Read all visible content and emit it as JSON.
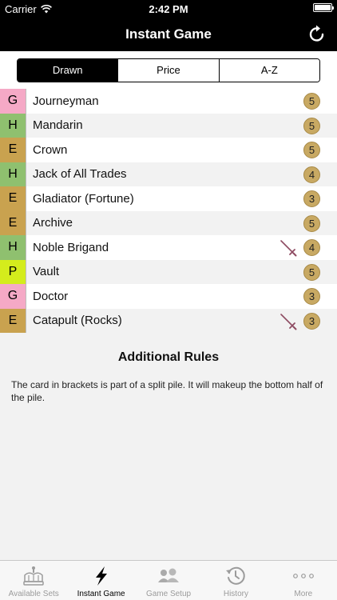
{
  "status_bar": {
    "carrier": "Carrier",
    "time": "2:42 PM",
    "battery_level": 1.0
  },
  "nav": {
    "title": "Instant Game",
    "refresh_icon": "refresh-icon"
  },
  "segments": [
    {
      "label": "Drawn",
      "active": true
    },
    {
      "label": "Price",
      "active": false
    },
    {
      "label": "A-Z",
      "active": false
    }
  ],
  "set_colors": {
    "G": "#f5a9c6",
    "H": "#8fc06f",
    "E": "#c9a24f",
    "P": "#d4ec1c"
  },
  "cards": [
    {
      "set": "G",
      "name": "Journeyman",
      "cost": "5",
      "attack": false
    },
    {
      "set": "H",
      "name": "Mandarin",
      "cost": "5",
      "attack": false
    },
    {
      "set": "E",
      "name": "Crown",
      "cost": "5",
      "attack": false
    },
    {
      "set": "H",
      "name": "Jack of All Trades",
      "cost": "4",
      "attack": false
    },
    {
      "set": "E",
      "name": "Gladiator (Fortune)",
      "cost": "3",
      "attack": false
    },
    {
      "set": "E",
      "name": "Archive",
      "cost": "5",
      "attack": false
    },
    {
      "set": "H",
      "name": "Noble Brigand",
      "cost": "4",
      "attack": true
    },
    {
      "set": "P",
      "name": "Vault",
      "cost": "5",
      "attack": false
    },
    {
      "set": "G",
      "name": "Doctor",
      "cost": "3",
      "attack": false
    },
    {
      "set": "E",
      "name": "Catapult (Rocks)",
      "cost": "3",
      "attack": true
    }
  ],
  "rules": {
    "title": "Additional Rules",
    "text": "The card in brackets is part of a split pile. It will makeup the bottom half of the pile."
  },
  "tabs": [
    {
      "label": "Available Sets",
      "icon": "crown-icon",
      "active": false
    },
    {
      "label": "Instant Game",
      "icon": "lightning-icon",
      "active": true
    },
    {
      "label": "Game Setup",
      "icon": "people-icon",
      "active": false
    },
    {
      "label": "History",
      "icon": "history-clock-icon",
      "active": false
    },
    {
      "label": "More",
      "icon": "more-dots-icon",
      "active": false
    }
  ]
}
